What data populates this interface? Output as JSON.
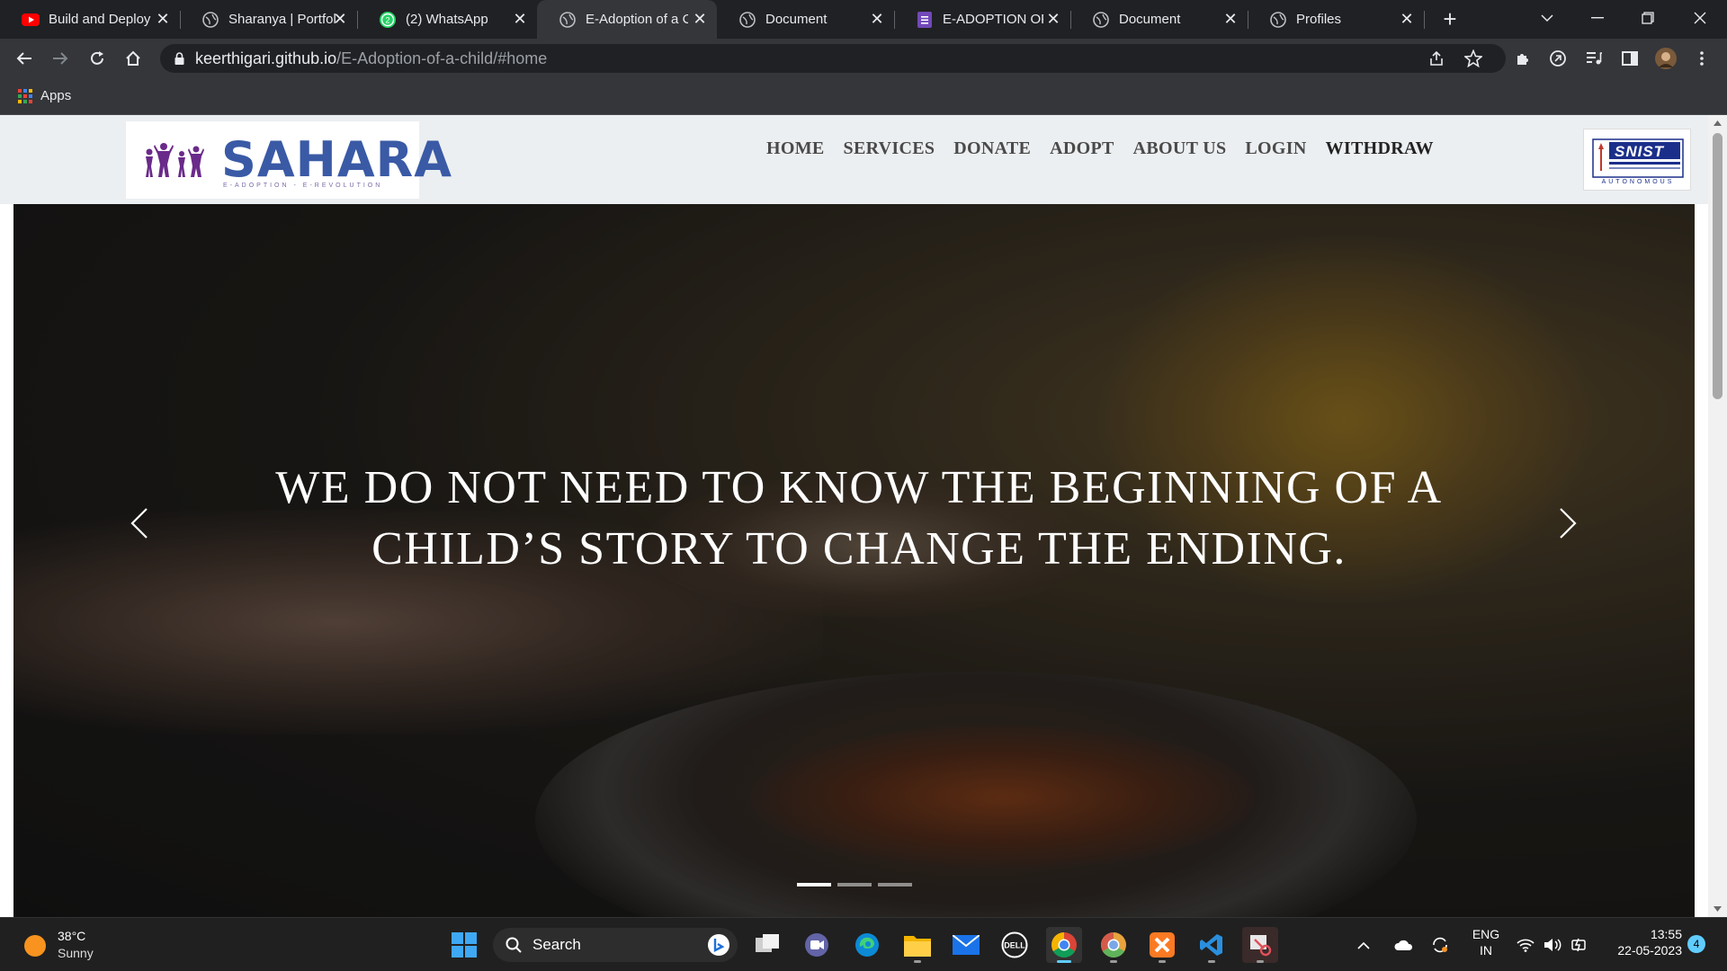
{
  "tabs": [
    {
      "title": "Build and Deploy",
      "icon": "youtube-icon",
      "active": false
    },
    {
      "title": "Sharanya | Portfol",
      "icon": "globe-icon",
      "active": false
    },
    {
      "title": "(2) WhatsApp",
      "icon": "whatsapp-icon",
      "active": false,
      "badge": "2"
    },
    {
      "title": "E-Adoption of a C",
      "icon": "globe-icon",
      "active": true
    },
    {
      "title": "Document",
      "icon": "globe-icon",
      "active": false
    },
    {
      "title": "E-ADOPTION OF",
      "icon": "forms-icon",
      "active": false
    },
    {
      "title": "Document",
      "icon": "globe-icon",
      "active": false
    },
    {
      "title": "Profiles",
      "icon": "globe-icon",
      "active": false
    }
  ],
  "address_bar": {
    "host": "keerthigari.github.io",
    "path": "/E-Adoption-of-a-child/#home"
  },
  "bookmarks": {
    "apps_label": "Apps"
  },
  "site": {
    "brand": "SAHARA",
    "brand_tagline": "E-ADOPTION - E-REVOLUTION",
    "nav": [
      "HOME",
      "SERVICES",
      "DONATE",
      "ADOPT",
      "ABOUT US",
      "LOGIN",
      "WITHDRAW"
    ],
    "partner_logo_text": "SNIST",
    "partner_logo_sub": "AUTONOMOUS",
    "hero": {
      "headline": "WE DO NOT NEED TO KNOW THE BEGINNING OF A CHILD’S STORY TO CHANGE THE ENDING.",
      "slides": 3,
      "active_slide": 1
    }
  },
  "taskbar": {
    "weather_temp": "38°C",
    "weather_desc": "Sunny",
    "search_label": "Search",
    "lang_top": "ENG",
    "lang_bottom": "IN",
    "time": "13:55",
    "date": "22-05-2023",
    "notification_count": "4"
  },
  "colors": {
    "brand_blue": "#3a5aa6",
    "brand_purple": "#6a2a8a",
    "taskbar_accent": "#60cdff"
  }
}
